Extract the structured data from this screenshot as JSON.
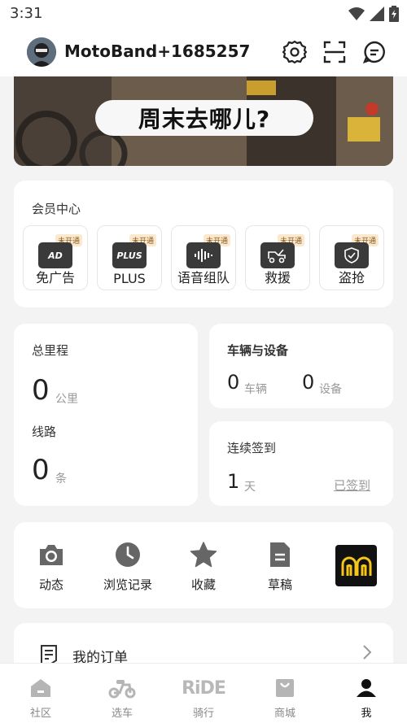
{
  "status_bar": {
    "time": "3:31",
    "icons": [
      "wifi-icon",
      "signal-icon",
      "battery-icon"
    ]
  },
  "header": {
    "username": "MotoBand+1685257",
    "actions": [
      "gear-icon",
      "scan-icon",
      "message-icon"
    ]
  },
  "banner": {
    "text": "周末去哪儿?"
  },
  "membership": {
    "title": "会员中心",
    "items": [
      {
        "label": "免广告",
        "badge": "未开通",
        "icon_text": "AD"
      },
      {
        "label": "PLUS",
        "badge": "未开通",
        "icon_text": "PLUS"
      },
      {
        "label": "语音组队",
        "badge": "未开通",
        "icon_text": ""
      },
      {
        "label": "救援",
        "badge": "未开通",
        "icon_text": ""
      },
      {
        "label": "盗抢",
        "badge": "未开通",
        "icon_text": ""
      }
    ]
  },
  "stats": {
    "mileage": {
      "label": "总里程",
      "value": "0",
      "unit": "公里"
    },
    "routes": {
      "label": "线路",
      "value": "0",
      "unit": "条"
    },
    "vehicles": {
      "title": "车辆与设备",
      "vehicle_count": "0",
      "vehicle_unit": "车辆",
      "device_count": "0",
      "device_unit": "设备"
    },
    "checkin": {
      "title": "连续签到",
      "days": "1",
      "unit": "天",
      "action": "已签到"
    }
  },
  "tools": [
    {
      "label": "动态",
      "icon": "camera-icon"
    },
    {
      "label": "浏览记录",
      "icon": "clock-icon"
    },
    {
      "label": "收藏",
      "icon": "star-icon"
    },
    {
      "label": "草稿",
      "icon": "document-icon"
    }
  ],
  "orders": {
    "label": "我的订单"
  },
  "tab_bar": [
    {
      "label": "社区",
      "icon": "home-icon"
    },
    {
      "label": "选车",
      "icon": "scooter-icon"
    },
    {
      "label": "骑行",
      "icon": "ride-logo",
      "logo_text": "RiDE"
    },
    {
      "label": "商城",
      "icon": "shop-icon"
    },
    {
      "label": "我",
      "icon": "person-icon",
      "active": true
    }
  ],
  "colors": {
    "accent": "#222222",
    "badge_bg": "#fbe9cf",
    "promo_yellow": "#f5c518"
  }
}
